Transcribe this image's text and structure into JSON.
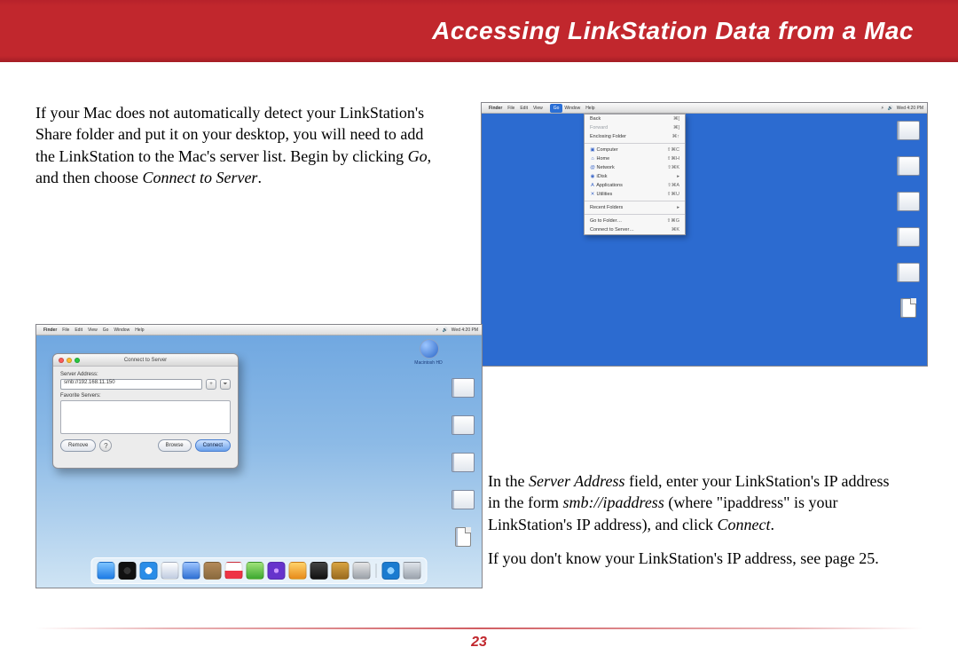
{
  "header": {
    "title": "Accessing LinkStation Data from a Mac"
  },
  "page_number": "23",
  "para1": {
    "t1": "If your Mac does not automatically detect your LinkStation's Share folder and put it on your desktop, you will need to add the LinkStation to the Mac's server list.  Begin by clicking ",
    "go": "Go",
    "t2": ", and then choose ",
    "cts": "Connect to Server",
    "t3": "."
  },
  "para2": {
    "t1": "In the ",
    "sa": "Server Address",
    "t2": " field, enter your LinkStation's IP address in the form ",
    "smb": "smb://ipaddress",
    "t3": " (where \"ipaddress\" is your LinkStation's IP address), and click ",
    "connect": "Connect",
    "t4": "."
  },
  "para3": "If you don't know your LinkStation's IP address, see page 25.",
  "mac_menubar": {
    "apple": "",
    "items": [
      "Finder",
      "File",
      "Edit",
      "View",
      "Go",
      "Window",
      "Help"
    ],
    "selected_index": 4,
    "right_time": "Wed 4:20 PM"
  },
  "go_menu": {
    "rows": [
      {
        "label": "Back",
        "kbd": "⌘["
      },
      {
        "label": "Forward",
        "kbd": "⌘]",
        "disabled": true
      },
      {
        "label": "Enclosing Folder",
        "kbd": "⌘↑"
      },
      {
        "sep": true
      },
      {
        "icon": "computer-icon",
        "label": "Computer",
        "kbd": "⇧⌘C"
      },
      {
        "icon": "home-icon",
        "label": "Home",
        "kbd": "⇧⌘H"
      },
      {
        "icon": "network-icon",
        "label": "Network",
        "kbd": "⇧⌘K"
      },
      {
        "icon": "idisk-icon",
        "label": "iDisk",
        "kbd": "▸"
      },
      {
        "icon": "apps-icon",
        "label": "Applications",
        "kbd": "⇧⌘A"
      },
      {
        "icon": "utils-icon",
        "label": "Utilities",
        "kbd": "⇧⌘U"
      },
      {
        "sep": true
      },
      {
        "label": "Recent Folders",
        "kbd": "▸"
      },
      {
        "sep": true
      },
      {
        "label": "Go to Folder…",
        "kbd": "⇧⌘G"
      },
      {
        "label": "Connect to Server…",
        "kbd": "⌘K"
      }
    ]
  },
  "cts": {
    "title": "Connect to Server",
    "addr_label": "Server Address:",
    "addr_value": "smb://192.168.11.150",
    "fav_label": "Favorite Servers:",
    "btn_remove": "Remove",
    "btn_browse": "Browse",
    "btn_connect": "Connect"
  },
  "spotlight_label": "Macintosh HD",
  "desk_labels": [
    "",
    "",
    "",
    "",
    "",
    ""
  ]
}
